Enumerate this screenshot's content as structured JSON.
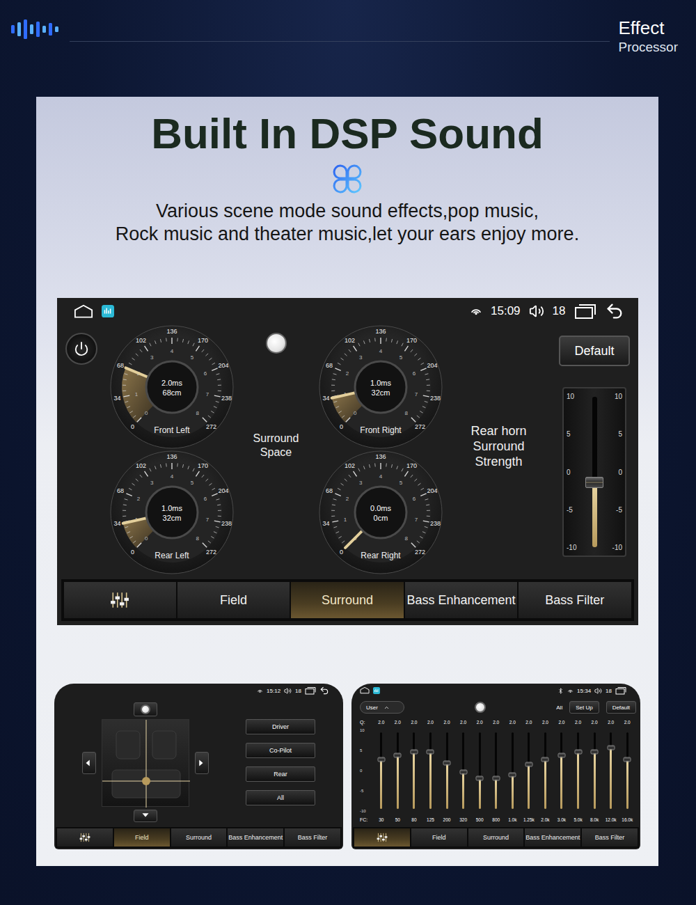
{
  "header": {
    "title": "Effect",
    "subtitle": "Processor"
  },
  "hero": {
    "title": "Built In DSP Sound",
    "lines": [
      "Various scene mode sound effects,pop music,",
      "Rock music and theater music,let your ears enjoy more."
    ]
  },
  "main_screen": {
    "status": {
      "time": "15:09",
      "volume": "18"
    },
    "dial_scale": {
      "outer": [
        "0",
        "34",
        "68",
        "102",
        "136",
        "170",
        "204",
        "238",
        "272"
      ],
      "inner": [
        "0",
        "1",
        "2",
        "3",
        "4",
        "5",
        "6",
        "7",
        "8"
      ]
    },
    "dials": [
      {
        "name": "Front Left",
        "delay": "2.0ms",
        "distance": "68cm",
        "level": 0.25
      },
      {
        "name": "Front Right",
        "delay": "1.0ms",
        "distance": "32cm",
        "level": 0.12
      },
      {
        "name": "Rear Left",
        "delay": "1.0ms",
        "distance": "32cm",
        "level": 0.12
      },
      {
        "name": "Rear Right",
        "delay": "0.0ms",
        "distance": "0cm",
        "level": 0.0
      }
    ],
    "center_label": "Surround Space",
    "slider": {
      "label": "Rear horn Surround Strength",
      "ticks": [
        "10",
        "5",
        "0",
        "-5",
        "-10"
      ],
      "level": 0.43
    },
    "default_button": "Default",
    "tabs": [
      {
        "label": "",
        "kind": "icon",
        "selected": false
      },
      {
        "label": "Field",
        "kind": "text",
        "selected": false
      },
      {
        "label": "Surround",
        "kind": "text",
        "selected": true
      },
      {
        "label": "Bass Enhancement",
        "kind": "text",
        "selected": false
      },
      {
        "label": "Bass Filter",
        "kind": "text",
        "selected": false
      }
    ]
  },
  "field_screen": {
    "status": {
      "time": "15:12",
      "volume": "18"
    },
    "buttons": [
      {
        "label": "Driver",
        "selected": false
      },
      {
        "label": "Co-Pilot",
        "selected": false
      },
      {
        "label": "Rear",
        "selected": false
      },
      {
        "label": "All",
        "selected": false
      }
    ],
    "tabs": [
      {
        "label": "",
        "kind": "icon",
        "selected": false
      },
      {
        "label": "Field",
        "kind": "text",
        "selected": true
      },
      {
        "label": "Surround",
        "kind": "text",
        "selected": false
      },
      {
        "label": "Bass Enhancement",
        "kind": "text",
        "selected": false
      },
      {
        "label": "Bass Filter",
        "kind": "text",
        "selected": false
      }
    ]
  },
  "eq_screen": {
    "status": {
      "time": "15:34",
      "volume": "18"
    },
    "preset": "User",
    "controls": [
      "All",
      "Set Up",
      "Default"
    ],
    "q_label": "Q:",
    "fc_label": "FC:",
    "axis": [
      "10",
      "5",
      "0",
      "-5",
      "-10"
    ],
    "bands": [
      {
        "q": "2.0",
        "fc": "30",
        "level": 0.65
      },
      {
        "q": "2.0",
        "fc": "50",
        "level": 0.7
      },
      {
        "q": "2.0",
        "fc": "80",
        "level": 0.75
      },
      {
        "q": "2.0",
        "fc": "125",
        "level": 0.75
      },
      {
        "q": "2.0",
        "fc": "200",
        "level": 0.6
      },
      {
        "q": "2.0",
        "fc": "320",
        "level": 0.48
      },
      {
        "q": "2.0",
        "fc": "500",
        "level": 0.4
      },
      {
        "q": "2.0",
        "fc": "800",
        "level": 0.4
      },
      {
        "q": "2.0",
        "fc": "1.0k",
        "level": 0.45
      },
      {
        "q": "2.0",
        "fc": "1.25k",
        "level": 0.58
      },
      {
        "q": "2.0",
        "fc": "2.0k",
        "level": 0.65
      },
      {
        "q": "2.0",
        "fc": "3.0k",
        "level": 0.7
      },
      {
        "q": "2.0",
        "fc": "5.0k",
        "level": 0.75
      },
      {
        "q": "2.0",
        "fc": "8.0k",
        "level": 0.75
      },
      {
        "q": "2.0",
        "fc": "12.0k",
        "level": 0.8
      },
      {
        "q": "2.0",
        "fc": "16.0k",
        "level": 0.65
      }
    ],
    "tabs": [
      {
        "label": "",
        "kind": "icon",
        "selected": true
      },
      {
        "label": "Field",
        "kind": "text",
        "selected": false
      },
      {
        "label": "Surround",
        "kind": "text",
        "selected": false
      },
      {
        "label": "Bass Enhancement",
        "kind": "text",
        "selected": false
      },
      {
        "label": "Bass Filter",
        "kind": "text",
        "selected": false
      }
    ]
  }
}
